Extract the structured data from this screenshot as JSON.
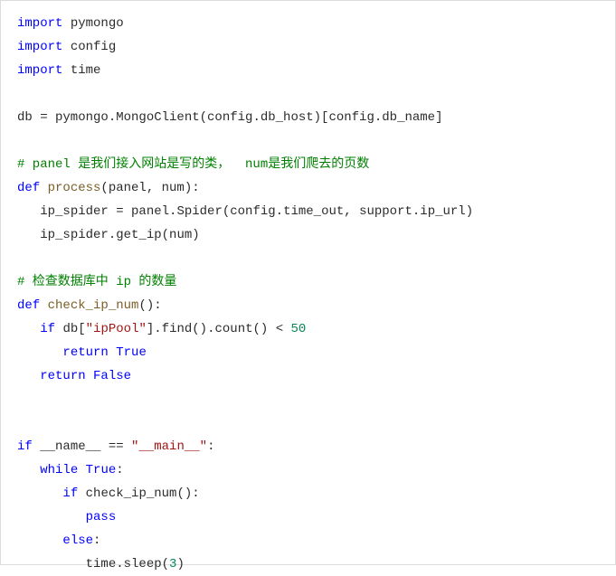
{
  "code": {
    "lines": [
      {
        "indent": 0,
        "tokens": [
          {
            "t": "import ",
            "c": "kw"
          },
          {
            "t": "pymongo",
            "c": "mod"
          }
        ]
      },
      {
        "indent": 0,
        "tokens": [
          {
            "t": "import ",
            "c": "kw"
          },
          {
            "t": "config",
            "c": "mod"
          }
        ]
      },
      {
        "indent": 0,
        "tokens": [
          {
            "t": "import ",
            "c": "kw"
          },
          {
            "t": "time",
            "c": "mod"
          }
        ]
      },
      {
        "indent": 0,
        "tokens": []
      },
      {
        "indent": 0,
        "tokens": [
          {
            "t": "db = pymongo.MongoClient(config.db_host)[config.db_name]",
            "c": "id"
          }
        ]
      },
      {
        "indent": 0,
        "tokens": []
      },
      {
        "indent": 0,
        "tokens": [
          {
            "t": "# panel 是我们接入网站是写的类，  num是我们爬去的页数",
            "c": "comment"
          }
        ]
      },
      {
        "indent": 0,
        "tokens": [
          {
            "t": "def ",
            "c": "kw"
          },
          {
            "t": "process",
            "c": "fn"
          },
          {
            "t": "(panel, num):",
            "c": "id"
          }
        ]
      },
      {
        "indent": 1,
        "tokens": [
          {
            "t": "ip_spider = panel.Spider(config.time_out, support.ip_url)",
            "c": "id"
          }
        ]
      },
      {
        "indent": 1,
        "tokens": [
          {
            "t": "ip_spider.get_ip(num)",
            "c": "id"
          }
        ]
      },
      {
        "indent": 0,
        "tokens": []
      },
      {
        "indent": 0,
        "tokens": [
          {
            "t": "# 检查数据库中 ip 的数量",
            "c": "comment"
          }
        ]
      },
      {
        "indent": 0,
        "tokens": [
          {
            "t": "def ",
            "c": "kw"
          },
          {
            "t": "check_ip_num",
            "c": "fn"
          },
          {
            "t": "():",
            "c": "id"
          }
        ]
      },
      {
        "indent": 1,
        "tokens": [
          {
            "t": "if ",
            "c": "kw"
          },
          {
            "t": "db[",
            "c": "id"
          },
          {
            "t": "\"ipPool\"",
            "c": "str"
          },
          {
            "t": "].find().count() < ",
            "c": "id"
          },
          {
            "t": "50",
            "c": "num"
          }
        ]
      },
      {
        "indent": 2,
        "tokens": [
          {
            "t": "return ",
            "c": "kw"
          },
          {
            "t": "True",
            "c": "bool"
          }
        ]
      },
      {
        "indent": 1,
        "tokens": [
          {
            "t": "return ",
            "c": "kw"
          },
          {
            "t": "False",
            "c": "bool"
          }
        ]
      },
      {
        "indent": 0,
        "tokens": []
      },
      {
        "indent": 0,
        "tokens": []
      },
      {
        "indent": 0,
        "tokens": [
          {
            "t": "if ",
            "c": "kw"
          },
          {
            "t": "__name__ == ",
            "c": "dunder"
          },
          {
            "t": "\"__main__\"",
            "c": "str"
          },
          {
            "t": ":",
            "c": "id"
          }
        ]
      },
      {
        "indent": 1,
        "tokens": [
          {
            "t": "while ",
            "c": "kw"
          },
          {
            "t": "True",
            "c": "bool"
          },
          {
            "t": ":",
            "c": "id"
          }
        ]
      },
      {
        "indent": 2,
        "tokens": [
          {
            "t": "if ",
            "c": "kw"
          },
          {
            "t": "check_ip_num():",
            "c": "id"
          }
        ]
      },
      {
        "indent": 3,
        "tokens": [
          {
            "t": "pass",
            "c": "kw"
          }
        ]
      },
      {
        "indent": 2,
        "tokens": [
          {
            "t": "else",
            "c": "kw"
          },
          {
            "t": ":",
            "c": "id"
          }
        ]
      },
      {
        "indent": 3,
        "tokens": [
          {
            "t": "time.sleep(",
            "c": "id"
          },
          {
            "t": "3",
            "c": "num"
          },
          {
            "t": ")",
            "c": "id"
          }
        ]
      }
    ],
    "indent_unit": "   "
  }
}
